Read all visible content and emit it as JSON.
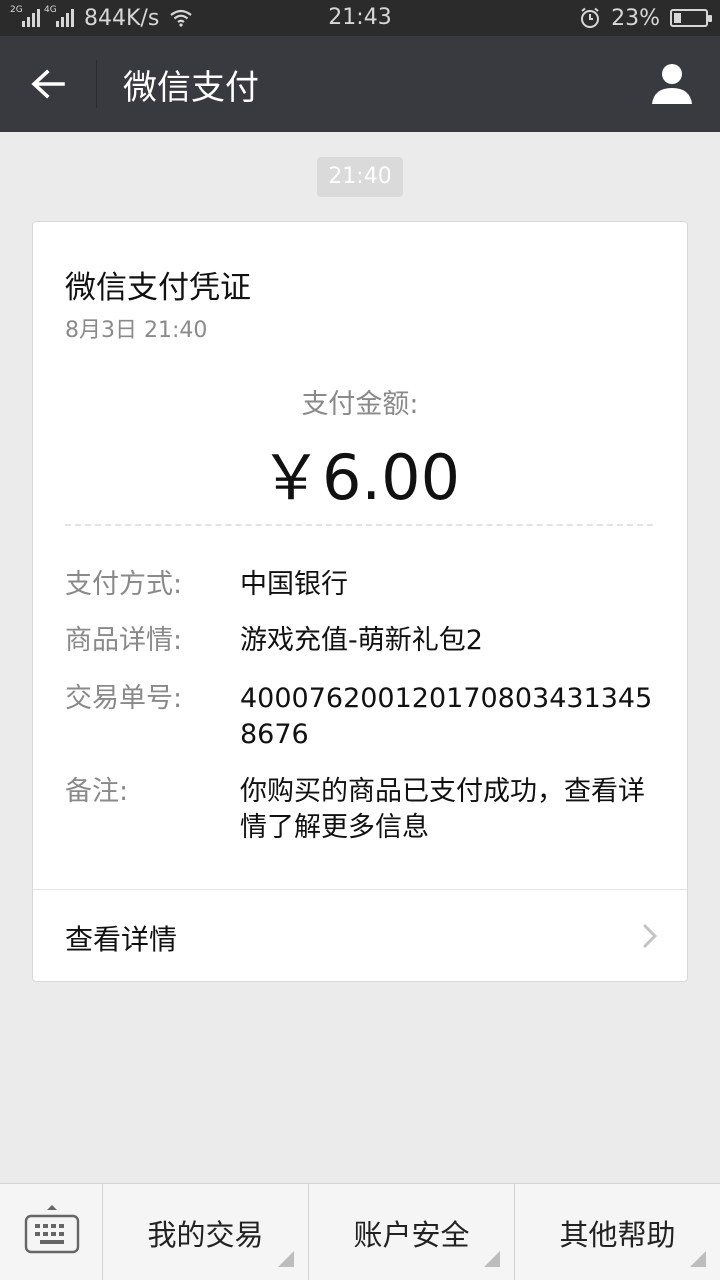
{
  "status_bar": {
    "net1": "2G",
    "net2": "4G",
    "speed": "844K/s",
    "time": "21:43",
    "battery": "23%",
    "battery_level": 0.23
  },
  "header": {
    "title": "微信支付",
    "back_icon": "arrow-left-icon",
    "profile_icon": "person-icon"
  },
  "message": {
    "time": "21:40"
  },
  "receipt": {
    "title": "微信支付凭证",
    "date": "8月3日  21:40",
    "amount_label": "支付金额:",
    "amount": "￥6.00",
    "fields": [
      {
        "label": "支付方式:",
        "value": "中国银行"
      },
      {
        "label": "商品详情:",
        "value": "游戏充值-萌新礼包2"
      },
      {
        "label": "交易单号:",
        "value": "4000762001201708034313458676"
      },
      {
        "label": "备注:",
        "value": "你购买的商品已支付成功，查看详情了解更多信息"
      }
    ],
    "view_details": "查看详情"
  },
  "bottom_menu": {
    "keyboard_icon": "keyboard-icon",
    "items": [
      {
        "label": "我的交易"
      },
      {
        "label": "账户安全"
      },
      {
        "label": "其他帮助"
      }
    ]
  },
  "colors": {
    "title_bar": "#393a3f",
    "status_bar": "#2b2b2b",
    "background": "#ebebeb"
  }
}
